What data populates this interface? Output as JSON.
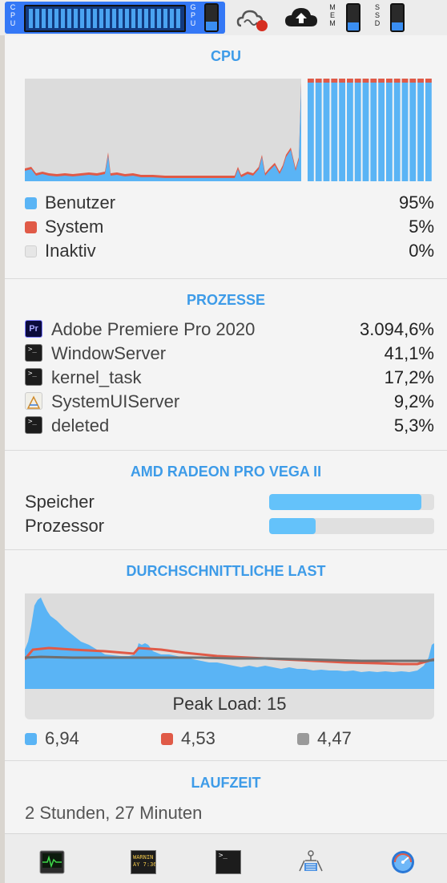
{
  "menubar": {
    "cpu_label": "CPU",
    "gpu_label": "GPU",
    "mem_label": "MEM",
    "ssd_label": "SSD",
    "gpu_level": 0.35,
    "mem_level": 0.3,
    "ssd_level": 0.3
  },
  "colors": {
    "accent": "#3d9be8",
    "user": "#5ab4f5",
    "system": "#e05a47",
    "idle": "#e6e6e6",
    "grey": "#9a9a9a",
    "bar": "#64c2fa"
  },
  "cpu": {
    "title": "CPU",
    "rows": [
      {
        "label": "Benutzer",
        "value": "95%"
      },
      {
        "label": "System",
        "value": "5%"
      },
      {
        "label": "Inaktiv",
        "value": "0%"
      }
    ]
  },
  "processes": {
    "title": "PROZESSE",
    "items": [
      {
        "name": "Adobe Premiere Pro 2020",
        "value": "3.094,6%",
        "icon": "premiere-pro-icon",
        "icon_text": "Pr"
      },
      {
        "name": "WindowServer",
        "value": "41,1%",
        "icon": "terminal-icon"
      },
      {
        "name": "kernel_task",
        "value": "17,2%",
        "icon": "terminal-icon"
      },
      {
        "name": "SystemUIServer",
        "value": "9,2%",
        "icon": "system-ui-server-icon"
      },
      {
        "name": "deleted",
        "value": "5,3%",
        "icon": "terminal-icon"
      }
    ]
  },
  "gpu": {
    "title": "AMD RADEON PRO VEGA II",
    "memory_label": "Speicher",
    "memory_level": 0.92,
    "processor_label": "Prozessor",
    "processor_level": 0.28
  },
  "load": {
    "title": "DURCHSCHNITTLICHE LAST",
    "peak": "Peak Load: 15",
    "legend": [
      {
        "value": "6,94",
        "color": "#5ab4f5"
      },
      {
        "value": "4,53",
        "color": "#e05a47"
      },
      {
        "value": "4,47",
        "color": "#9a9a9a"
      }
    ]
  },
  "uptime": {
    "title": "LAUFZEIT",
    "value": "2 Stunden, 27 Minuten"
  },
  "footer": {
    "console_icon_text": "WARNIN\nAY 7:36",
    "icons": [
      "activity-monitor-icon",
      "console-icon",
      "terminal-icon",
      "system-information-icon",
      "disk-utility-icon"
    ]
  }
}
